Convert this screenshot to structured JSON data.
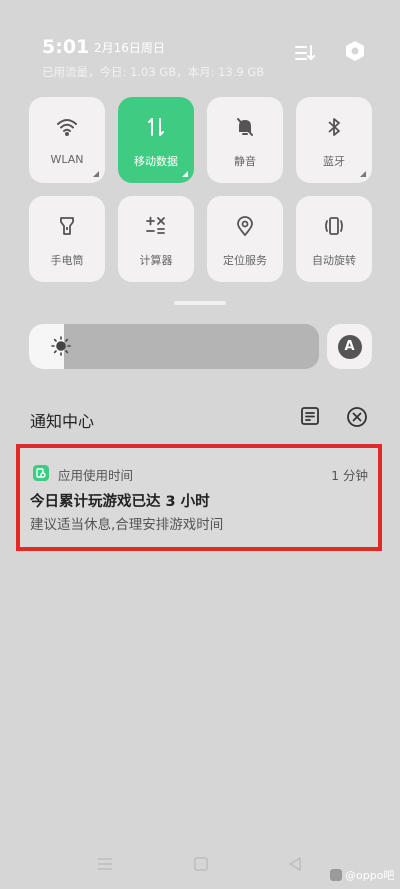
{
  "status": {
    "time": "5:01",
    "date": "2月16日周日",
    "data_usage": "已用流量，今日: 1.03 GB，本月: 13.9 GB"
  },
  "top_icons": {
    "edit": "edit-tiles-icon",
    "settings": "settings-hexagon-icon"
  },
  "tiles": [
    {
      "label": "WLAN",
      "icon": "wifi-icon",
      "active": false
    },
    {
      "label": "移动数据",
      "icon": "mobile-data-icon",
      "active": true
    },
    {
      "label": "静音",
      "icon": "bell-off-icon",
      "active": false
    },
    {
      "label": "蓝牙",
      "icon": "bluetooth-icon",
      "active": false
    },
    {
      "label": "手电筒",
      "icon": "flashlight-icon",
      "active": false
    },
    {
      "label": "计算器",
      "icon": "calculator-icon",
      "active": false
    },
    {
      "label": "定位服务",
      "icon": "location-pin-icon",
      "active": false
    },
    {
      "label": "自动旋转",
      "icon": "rotate-icon",
      "active": false
    }
  ],
  "brightness": {
    "level": 0.12,
    "auto_label": "A"
  },
  "notification_center": {
    "title": "通知中心",
    "notification": {
      "app_name": "应用使用时间",
      "time_ago": "1 分钟",
      "title": "今日累计玩游戏已达 3 小时",
      "body": "建议适当休息,合理安排游戏时间"
    }
  },
  "watermark": "@oppo吧",
  "colors": {
    "accent": "#3fcc82",
    "highlight_border": "#e02a2a"
  }
}
